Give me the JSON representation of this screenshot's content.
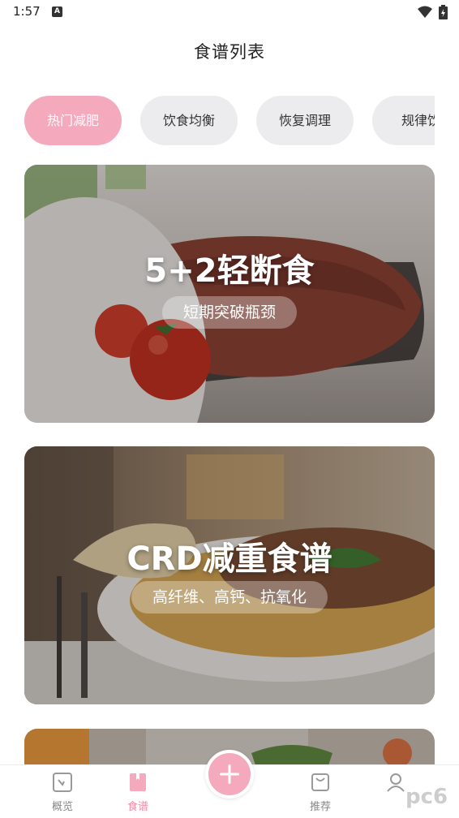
{
  "status_bar": {
    "time": "1:57",
    "notification_glyph": "A"
  },
  "header": {
    "title": "食谱列表"
  },
  "tabs": [
    {
      "label": "热门减肥",
      "active": true
    },
    {
      "label": "饮食均衡",
      "active": false
    },
    {
      "label": "恢复调理",
      "active": false
    },
    {
      "label": "规律饮",
      "active": false
    }
  ],
  "cards": [
    {
      "title": "5+2轻断食",
      "subtitle": "短期突破瓶颈"
    },
    {
      "title": "CRD减重食谱",
      "subtitle": "高纤维、高钙、抗氧化"
    }
  ],
  "bottom_nav": {
    "items": [
      {
        "label": "概览",
        "icon": "chart-frame-icon",
        "active": false
      },
      {
        "label": "食谱",
        "icon": "recipe-book-icon",
        "active": true
      },
      {
        "label": "推荐",
        "icon": "shopping-bag-icon",
        "active": false
      },
      {
        "label": "",
        "icon": "user-icon",
        "active": false
      }
    ],
    "fab_icon": "plus-icon"
  },
  "watermark": {
    "text": "pc6"
  },
  "colors": {
    "accent": "#f5a9bd",
    "active_text": "#f08aa6",
    "tab_bg": "#ececee"
  }
}
